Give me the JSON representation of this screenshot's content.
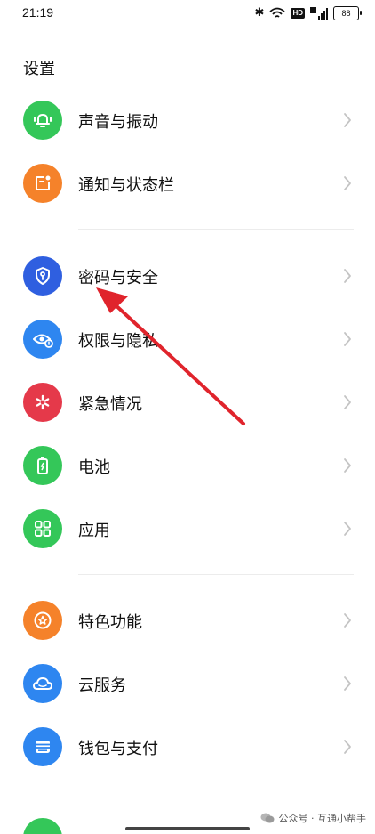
{
  "status_bar": {
    "time": "21:19",
    "hd_label": "HD",
    "battery_level": "88"
  },
  "page_title": "设置",
  "items": [
    {
      "label": "声音与振动",
      "icon": "bell-vibrate-icon",
      "color": "#34C759"
    },
    {
      "label": "通知与状态栏",
      "icon": "notification-icon",
      "color": "#F5822A"
    },
    {
      "label": "密码与安全",
      "icon": "shield-key-icon",
      "color": "#2F5FE0"
    },
    {
      "label": "权限与隐私",
      "icon": "eye-privacy-icon",
      "color": "#2E86F0"
    },
    {
      "label": "紧急情况",
      "icon": "emergency-asterisk-icon",
      "color": "#E5394A"
    },
    {
      "label": "电池",
      "icon": "battery-icon",
      "color": "#34C759"
    },
    {
      "label": "应用",
      "icon": "apps-grid-icon",
      "color": "#34C759"
    },
    {
      "label": "特色功能",
      "icon": "star-badge-icon",
      "color": "#F5822A"
    },
    {
      "label": "云服务",
      "icon": "cloud-icon",
      "color": "#2E86F0"
    },
    {
      "label": "钱包与支付",
      "icon": "wallet-icon",
      "color": "#2E86F0"
    }
  ],
  "annotation_arrow_color": "#E0242C",
  "watermark": "公众号 · 互通小帮手"
}
